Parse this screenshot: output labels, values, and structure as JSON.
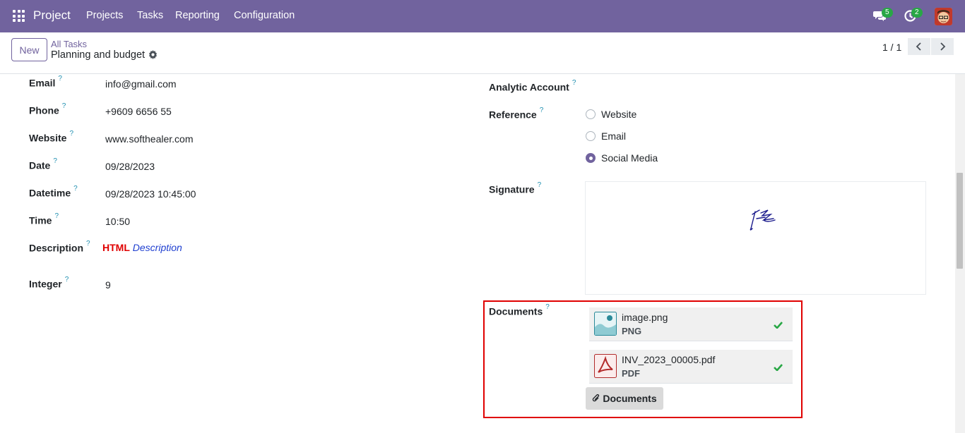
{
  "navbar": {
    "brand": "Project",
    "menu": [
      "Projects",
      "Tasks",
      "Reporting",
      "Configuration"
    ],
    "messages_count": "5",
    "activities_count": "2",
    "bg_color": "#71639e"
  },
  "control_panel": {
    "new_label": "New",
    "breadcrumb_parent": "All Tasks",
    "breadcrumb_current": "Planning and budget",
    "pager_value": "1 / 1"
  },
  "left_fields": {
    "email": {
      "label": "Email",
      "value": "info@gmail.com"
    },
    "phone": {
      "label": "Phone",
      "value": "+9609 6656 55"
    },
    "website": {
      "label": "Website",
      "value": "www.softhealer.com"
    },
    "date": {
      "label": "Date",
      "value": "09/28/2023"
    },
    "datetime": {
      "label": "Datetime",
      "value": "09/28/2023 10:45:00"
    },
    "time": {
      "label": "Time",
      "value": "10:50"
    },
    "description": {
      "label": "Description",
      "html_part": "HTML",
      "italic_part": "Description"
    },
    "integer": {
      "label": "Integer",
      "value": "9"
    }
  },
  "right_fields": {
    "analytic_account": {
      "label": "Analytic Account"
    },
    "reference": {
      "label": "Reference",
      "options": [
        "Website",
        "Email",
        "Social Media"
      ],
      "selected": "Social Media"
    },
    "signature": {
      "label": "Signature"
    },
    "documents": {
      "label": "Documents",
      "attachments": [
        {
          "name": "image.png",
          "ext": "PNG",
          "icon": "image-file-icon"
        },
        {
          "name": "INV_2023_00005.pdf",
          "ext": "PDF",
          "icon": "pdf-file-icon"
        }
      ],
      "button_label": "Documents"
    }
  },
  "help_mark": "?"
}
